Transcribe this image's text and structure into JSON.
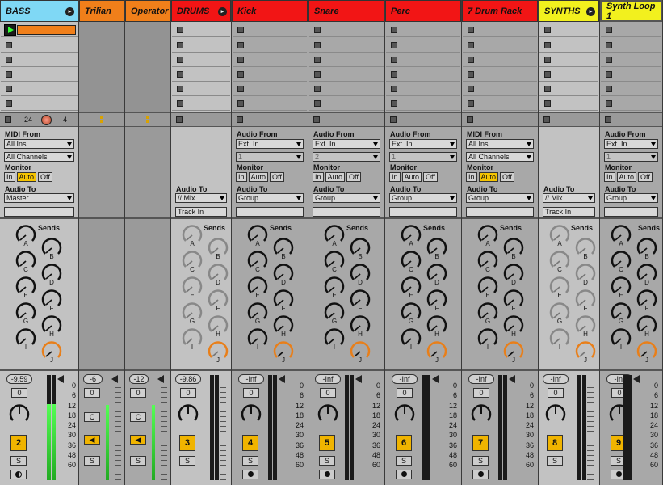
{
  "tracks": [
    {
      "id": "bass",
      "name": "BASS",
      "color": "#7fd8f5",
      "group": true,
      "fold": "▸"
    },
    {
      "id": "trilian",
      "name": "Trilian",
      "color": "#f07f1a"
    },
    {
      "id": "operator",
      "name": "Operator",
      "color": "#f07f1a"
    },
    {
      "id": "drums",
      "name": "DRUMS",
      "color": "#f21515",
      "group": true,
      "fold": "▸"
    },
    {
      "id": "kick",
      "name": "Kick",
      "color": "#f21515"
    },
    {
      "id": "snare",
      "name": "Snare",
      "color": "#f21515"
    },
    {
      "id": "perc",
      "name": "Perc",
      "color": "#f21515"
    },
    {
      "id": "drumrack",
      "name": "7 Drum Rack",
      "color": "#f21515"
    },
    {
      "id": "synths",
      "name": "SYNTHS",
      "color": "#f2f01e",
      "group": true,
      "fold": "▸"
    },
    {
      "id": "synthloop",
      "name": "Synth Loop 1",
      "color": "#f2f01e"
    }
  ],
  "bass": {
    "count": "24",
    "num": "4",
    "midi_from": "MIDI From",
    "midi_in": "All Ins",
    "midi_ch": "All Channels",
    "monitor": "Monitor",
    "mon_in": "In",
    "mon_auto": "Auto",
    "mon_off": "Off",
    "audio_to": "Audio To",
    "audio_to_val": "Master",
    "sends": "Sends",
    "vol": "-9.59",
    "pan": "0",
    "trk": "2",
    "solo": "S"
  },
  "trilian": {
    "vol": "-6",
    "pan": "0",
    "c": "C",
    "solo": "S"
  },
  "operator": {
    "vol": "-12",
    "pan": "0",
    "c": "C",
    "solo": "S"
  },
  "drums": {
    "audio_to": "Audio To",
    "audio_to_val": "// Mix",
    "sub": "Track In",
    "sends": "Sends",
    "vol": "-9.86",
    "pan": "0",
    "trk": "3",
    "solo": "S"
  },
  "kick": {
    "audio_from": "Audio From",
    "src": "Ext. In",
    "ch": "1",
    "monitor": "Monitor",
    "mon_in": "In",
    "mon_auto": "Auto",
    "mon_off": "Off",
    "audio_to": "Audio To",
    "audio_to_val": "Group",
    "sends": "Sends",
    "vol": "-Inf",
    "pan": "0",
    "trk": "4",
    "solo": "S"
  },
  "snare": {
    "audio_from": "Audio From",
    "src": "Ext. In",
    "ch": "2",
    "monitor": "Monitor",
    "mon_in": "In",
    "mon_auto": "Auto",
    "mon_off": "Off",
    "audio_to": "Audio To",
    "audio_to_val": "Group",
    "sends": "Sends",
    "vol": "-Inf",
    "pan": "0",
    "trk": "5",
    "solo": "S"
  },
  "perc": {
    "audio_from": "Audio From",
    "src": "Ext. In",
    "ch": "1",
    "monitor": "Monitor",
    "mon_in": "In",
    "mon_auto": "Auto",
    "mon_off": "Off",
    "audio_to": "Audio To",
    "audio_to_val": "Group",
    "sends": "Sends",
    "vol": "-Inf",
    "pan": "0",
    "trk": "6",
    "solo": "S"
  },
  "drumrack": {
    "midi_from": "MIDI From",
    "midi_in": "All Ins",
    "midi_ch": "All Channels",
    "monitor": "Monitor",
    "mon_in": "In",
    "mon_auto": "Auto",
    "mon_off": "Off",
    "audio_to": "Audio To",
    "audio_to_val": "Group",
    "sends": "Sends",
    "vol": "-Inf",
    "pan": "0",
    "trk": "7",
    "solo": "S"
  },
  "synths": {
    "audio_to": "Audio To",
    "audio_to_val": "// Mix",
    "sub": "Track In",
    "sends": "Sends",
    "vol": "-Inf",
    "pan": "0",
    "trk": "8",
    "solo": "S"
  },
  "synthloop": {
    "audio_from": "Audio From",
    "src": "Ext. In",
    "ch": "1",
    "monitor": "Monitor",
    "mon_in": "In",
    "mon_auto": "Auto",
    "mon_off": "Off",
    "audio_to": "Audio To",
    "audio_to_val": "Group",
    "sends": "Sends",
    "vol": "-Inf",
    "pan": "0",
    "trk": "9",
    "solo": "S"
  },
  "send_letters": [
    "A",
    "B",
    "C",
    "D",
    "E",
    "F",
    "G",
    "H",
    "I",
    "J"
  ],
  "meter_scale": [
    "0",
    "6",
    "12",
    "18",
    "24",
    "30",
    "36",
    "48",
    "60"
  ],
  "colors": {
    "track_number": "#f0b400",
    "active_clip": "#f07f1a",
    "monitor_on": "#f5c400",
    "send_j": "#e87f1a"
  }
}
